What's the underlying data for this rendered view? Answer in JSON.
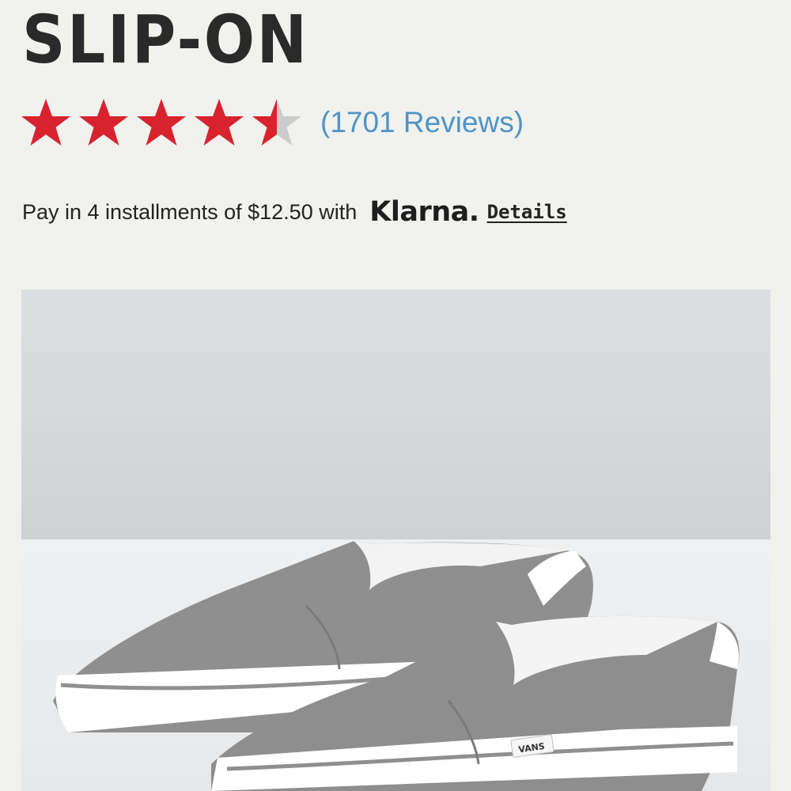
{
  "product": {
    "title": "SLIP-ON",
    "rating": {
      "value": 4.5,
      "max": 5,
      "star_color": "#d8232f",
      "empty_star_color": "#cccccc"
    },
    "reviews_label": "(1701 Reviews)"
  },
  "payment": {
    "text": "Pay in 4 installments of $12.50 with",
    "provider_logo": "Klarna.",
    "details_label": "Details"
  },
  "image": {
    "subject": "grey-slip-on-shoes",
    "brand_tag": "VANS",
    "shoe_color": "#8f8f8f",
    "background_color": "#d6d8db"
  }
}
